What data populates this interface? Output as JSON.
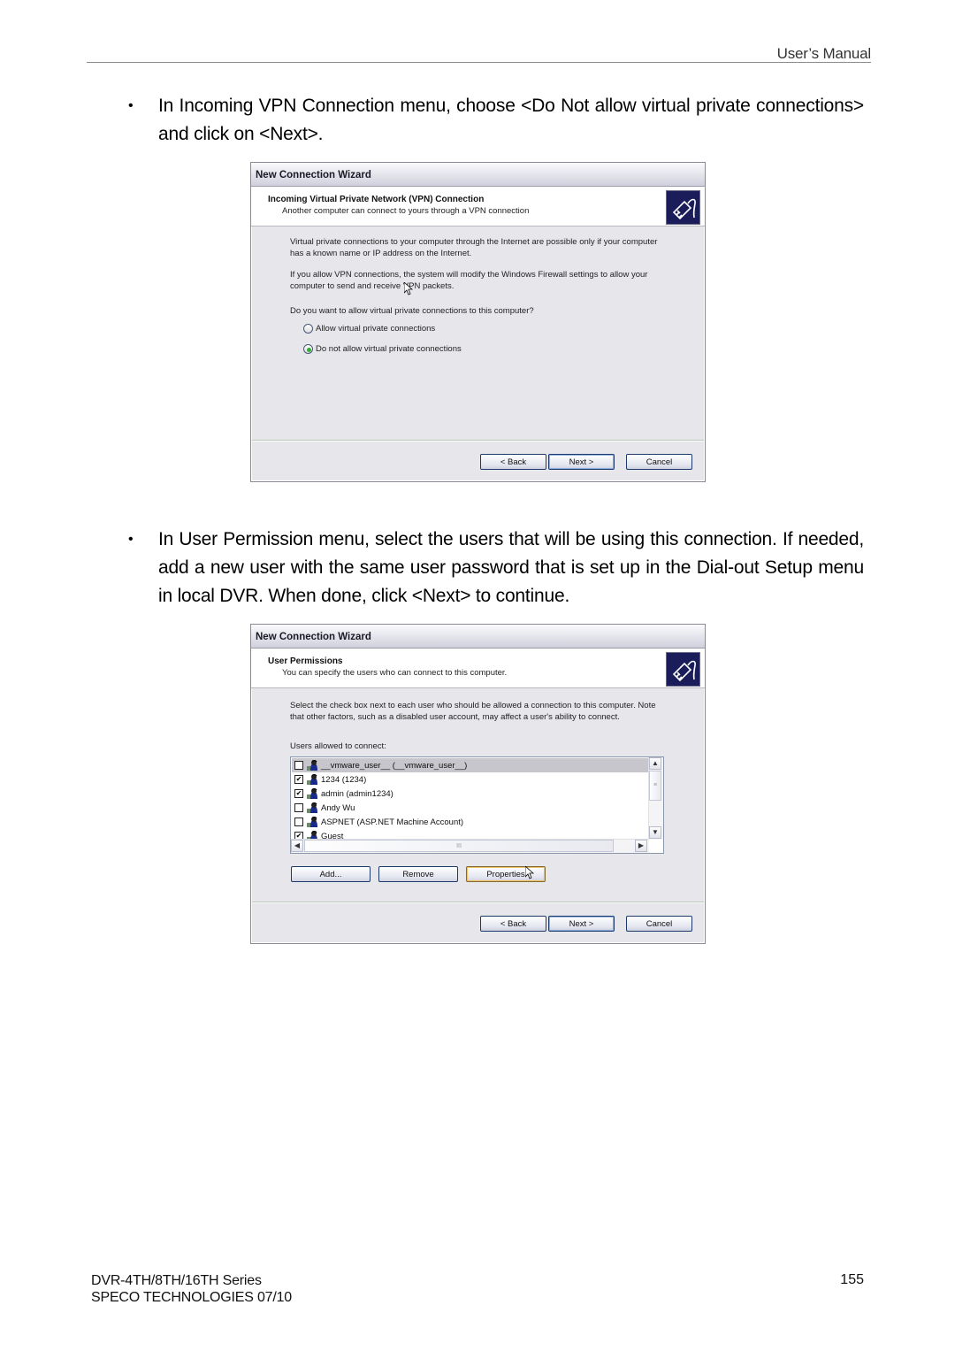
{
  "page_header": {
    "title": "User’s Manual"
  },
  "paragraphs": [
    {
      "bullet": "•",
      "text": "In Incoming VPN Connection menu, choose <Do Not allow virtual private connections> and click on <Next>."
    },
    {
      "bullet": "•",
      "text": "In User Permission menu, select the users that will be using this connection. If needed, add a new user with the same user password that is set up in the Dial-out Setup menu in local DVR. When done, click <Next> to continue."
    }
  ],
  "wizard_vpn": {
    "window_title": "New Connection Wizard",
    "header_title": "Incoming Virtual Private Network (VPN) Connection",
    "header_subtitle": "Another computer can connect to yours through a VPN connection",
    "header_icon": "network-cable-icon",
    "info_1": "Virtual private connections to your computer through the Internet are possible only if your computer has a known name or IP address on the Internet.",
    "info_2": "If you allow VPN connections, the system will modify the Windows Firewall settings to allow your computer to send and receive VPN packets.",
    "question": "Do you want to allow virtual private connections to this computer?",
    "options": [
      {
        "label": "Allow virtual private connections",
        "selected": false
      },
      {
        "label": "Do not allow virtual private connections",
        "selected": true
      }
    ],
    "buttons": {
      "back": "< Back",
      "next": "Next >",
      "cancel": "Cancel"
    }
  },
  "wizard_users": {
    "window_title": "New Connection Wizard",
    "header_title": "User Permissions",
    "header_subtitle": "You can specify the users who can connect to this computer.",
    "header_icon": "network-cable-icon",
    "info": "Select the check box next to each user who should be allowed a connection to this computer. Note that other factors, such as a disabled user account, may affect a user's ability to connect.",
    "list_label": "Users allowed to connect:",
    "users": [
      {
        "name": "__vmware_user__ (__vmware_user__)",
        "checked": false,
        "selected": true
      },
      {
        "name": "1234 (1234)",
        "checked": true,
        "selected": false
      },
      {
        "name": "admin (admin1234)",
        "checked": true,
        "selected": false
      },
      {
        "name": "Andy Wu",
        "checked": false,
        "selected": false
      },
      {
        "name": "ASPNET (ASP.NET Machine Account)",
        "checked": false,
        "selected": false
      },
      {
        "name": "Guest",
        "checked": true,
        "selected": false
      }
    ],
    "list_buttons": {
      "add": "Add...",
      "remove": "Remove",
      "properties": "Properties"
    },
    "scroll": {
      "up": "▲",
      "down": "▼",
      "left": "◀",
      "right": "▶",
      "grip": "≡",
      "hgrip": "III"
    },
    "buttons": {
      "back": "< Back",
      "next": "Next >",
      "cancel": "Cancel"
    }
  },
  "page_footer": {
    "series": "DVR-4TH/8TH/16TH Series",
    "company": "SPECO TECHNOLOGIES 07/10",
    "page_number": "155"
  }
}
